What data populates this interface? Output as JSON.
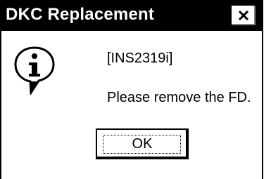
{
  "window": {
    "title": "DKC Replacement",
    "close_icon": "close-icon"
  },
  "message": {
    "icon": "info-balloon-icon",
    "code": "[INS2319i]",
    "text": "Please remove the FD."
  },
  "buttons": {
    "ok_label": "OK"
  }
}
